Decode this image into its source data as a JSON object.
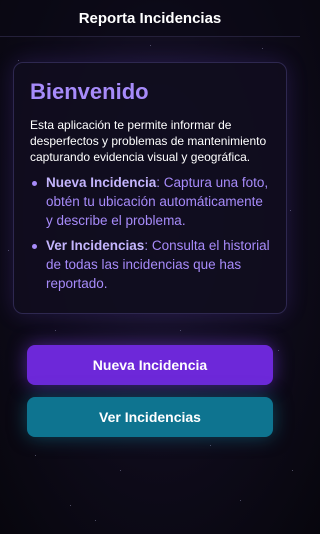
{
  "header": {
    "title": "Reporta Incidencias"
  },
  "welcome": {
    "title": "Bienvenido",
    "description": "Esta aplicación te permite informar de desperfectos y problemas de mantenimiento capturando evidencia visual y geográfica.",
    "features": [
      {
        "name": "Nueva Incidencia",
        "text": ": Captura una foto, obtén tu ubicación automáticamente y describe el problema."
      },
      {
        "name": "Ver Incidencias",
        "text": ": Consulta el historial de todas las incidencias que has reportado."
      }
    ]
  },
  "actions": {
    "new_label": "Nueva Incidencia",
    "view_label": "Ver Incidencias"
  },
  "colors": {
    "accent": "#a78bfa",
    "primary_button": "#6d28d9",
    "secondary_button": "#0e7490",
    "background": "#0e0b1a"
  }
}
